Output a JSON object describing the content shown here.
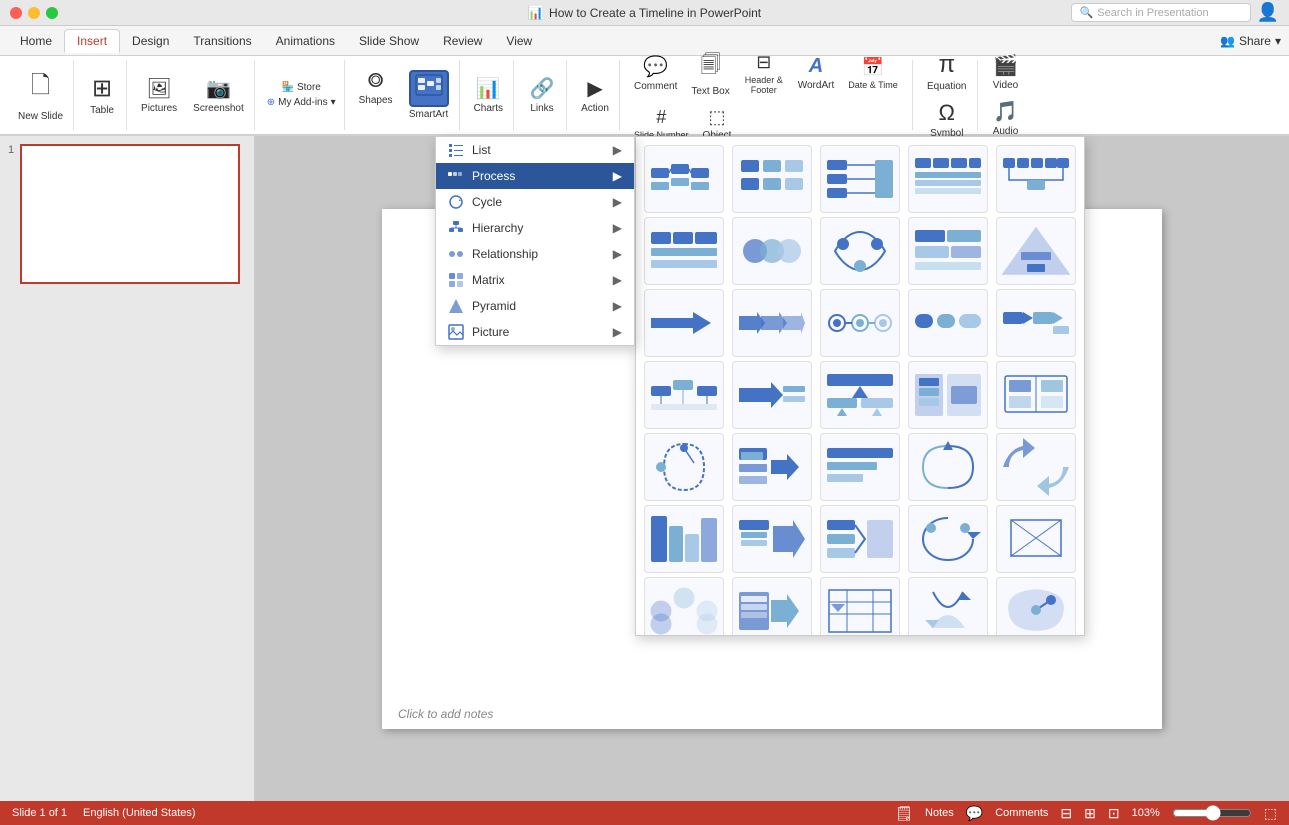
{
  "titlebar": {
    "title": "How to Create a Timeline in PowerPoint",
    "search_placeholder": "Search in Presentation"
  },
  "ribbon": {
    "tabs": [
      "Home",
      "Insert",
      "Design",
      "Transitions",
      "Animations",
      "Slide Show",
      "Review",
      "View"
    ],
    "active_tab": "Insert",
    "share_label": "Share",
    "groups": {
      "slides": {
        "new_slide": "New Slide"
      },
      "tables": {
        "table": "Table"
      },
      "images": {
        "pictures": "Pictures",
        "screenshot": "Screenshot"
      },
      "addins": {
        "store": "Store",
        "my_addins": "My Add-ins"
      },
      "illustrations": {
        "shapes": "Shapes",
        "smartart": "SmartArt"
      },
      "charts": {
        "charts": "Charts"
      },
      "links": {
        "links": "Links"
      },
      "action": {
        "action": "Action"
      },
      "text": {
        "comment": "Comment",
        "text_box": "Text Box",
        "header_footer": "Header & Footer",
        "wordart": "WordArt",
        "date_time": "Date & Time",
        "slide_number": "Slide Number",
        "object": "Object"
      },
      "symbols": {
        "equation": "Equation",
        "symbol": "Symbol"
      },
      "media": {
        "video": "Video",
        "audio": "Audio"
      }
    }
  },
  "smartart_menu": {
    "items": [
      {
        "id": "list",
        "label": "List",
        "icon": "☰",
        "has_submenu": true
      },
      {
        "id": "process",
        "label": "Process",
        "icon": "⋯",
        "has_submenu": true,
        "active": true
      },
      {
        "id": "cycle",
        "label": "Cycle",
        "icon": "○",
        "has_submenu": true
      },
      {
        "id": "hierarchy",
        "label": "Hierarchy",
        "icon": "⊞",
        "has_submenu": true
      },
      {
        "id": "relationship",
        "label": "Relationship",
        "icon": "◈",
        "has_submenu": true
      },
      {
        "id": "matrix",
        "label": "Matrix",
        "icon": "⊟",
        "has_submenu": true
      },
      {
        "id": "pyramid",
        "label": "Pyramid",
        "icon": "△",
        "has_submenu": true
      },
      {
        "id": "picture",
        "label": "Picture",
        "icon": "▣",
        "has_submenu": true
      }
    ]
  },
  "status_bar": {
    "slide_info": "Slide 1 of 1",
    "language": "English (United States)",
    "notes_label": "Notes",
    "comments_label": "Comments",
    "zoom": "103%"
  },
  "canvas": {
    "add_notes_text": "Click to add notes"
  }
}
